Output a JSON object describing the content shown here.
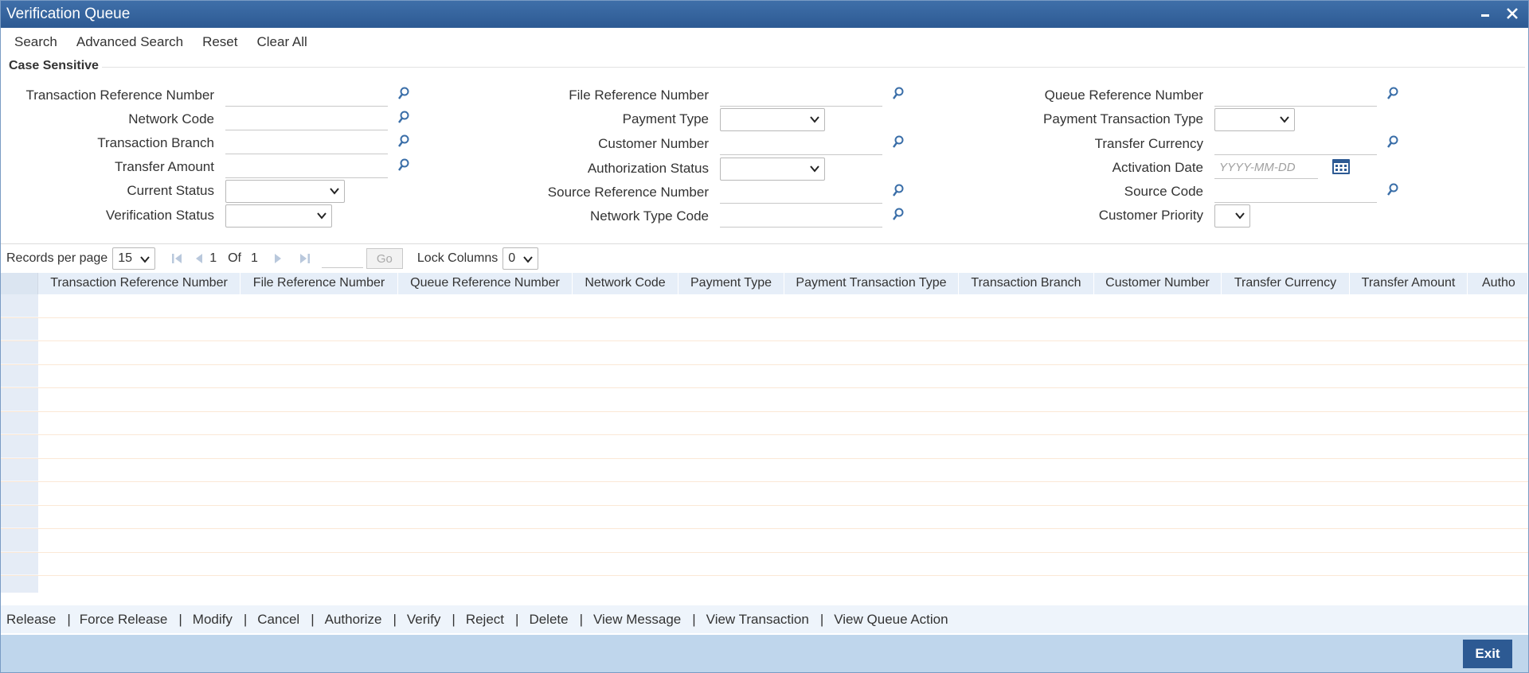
{
  "window": {
    "title": "Verification Queue"
  },
  "toolbar": [
    "Search",
    "Advanced Search",
    "Reset",
    "Clear All"
  ],
  "section": {
    "title": "Case Sensitive"
  },
  "fields": {
    "txn_ref": "Transaction Reference Number",
    "network_code": "Network Code",
    "txn_branch": "Transaction Branch",
    "transfer_amount": "Transfer Amount",
    "current_status": "Current Status",
    "verification_status": "Verification Status",
    "file_ref": "File Reference Number",
    "payment_type": "Payment Type",
    "customer_number": "Customer Number",
    "auth_status": "Authorization Status",
    "source_ref": "Source Reference Number",
    "network_type_code": "Network Type Code",
    "queue_ref": "Queue Reference Number",
    "payment_txn_type": "Payment Transaction Type",
    "transfer_currency": "Transfer Currency",
    "activation_date": "Activation Date",
    "activation_date_placeholder": "YYYY-MM-DD",
    "source_code": "Source Code",
    "customer_priority": "Customer Priority"
  },
  "pager": {
    "records_label": "Records per page",
    "records_value": "15",
    "page": "1",
    "of_label": "Of",
    "total": "1",
    "go_label": "Go",
    "lock_label": "Lock Columns",
    "lock_value": "0"
  },
  "grid": {
    "columns": [
      "Transaction Reference Number",
      "File Reference Number",
      "Queue Reference Number",
      "Network Code",
      "Payment Type",
      "Payment Transaction Type",
      "Transaction Branch",
      "Customer Number",
      "Transfer Currency",
      "Transfer Amount",
      "Autho"
    ],
    "row_count": 13
  },
  "actions": [
    "Release",
    "Force Release",
    "Modify",
    "Cancel",
    "Authorize",
    "Verify",
    "Reject",
    "Delete",
    "View Message",
    "View Transaction",
    "View Queue Action"
  ],
  "footer": {
    "exit_label": "Exit"
  },
  "colors": {
    "title_bar": "#2d5a93",
    "footer": "#bfd6ec",
    "accent": "#2d5a93"
  },
  "icons": {
    "lookup": "magnifier-icon",
    "calendar": "calendar-icon",
    "dropdown": "chevron-down-icon"
  }
}
